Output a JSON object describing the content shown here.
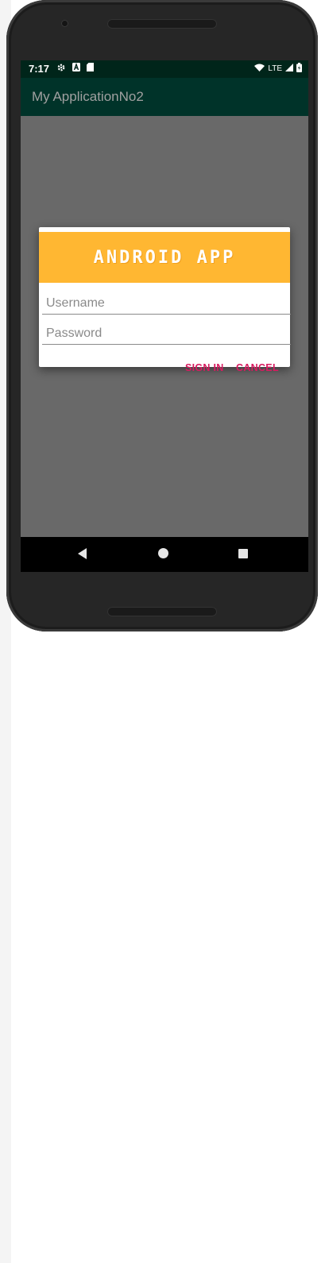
{
  "status_bar": {
    "time": "7:17",
    "network": "LTE"
  },
  "app_bar": {
    "title": "My ApplicationNo2"
  },
  "dialog": {
    "header_logo_text": "ANDROID APP",
    "username_placeholder": "Username",
    "password_placeholder": "Password",
    "sign_in_label": "SIGN IN",
    "cancel_label": "CANCEL"
  },
  "colors": {
    "status_bar": "#00251a",
    "app_bar": "#003329",
    "dialog_header": "#ffb732",
    "button_text": "#d81b60",
    "scrim": "#696969"
  },
  "icons": [
    "gear-icon",
    "a-letter-icon",
    "sd-card-icon",
    "wifi-icon",
    "signal-icon",
    "battery-icon",
    "back-icon",
    "home-icon",
    "recents-icon"
  ]
}
